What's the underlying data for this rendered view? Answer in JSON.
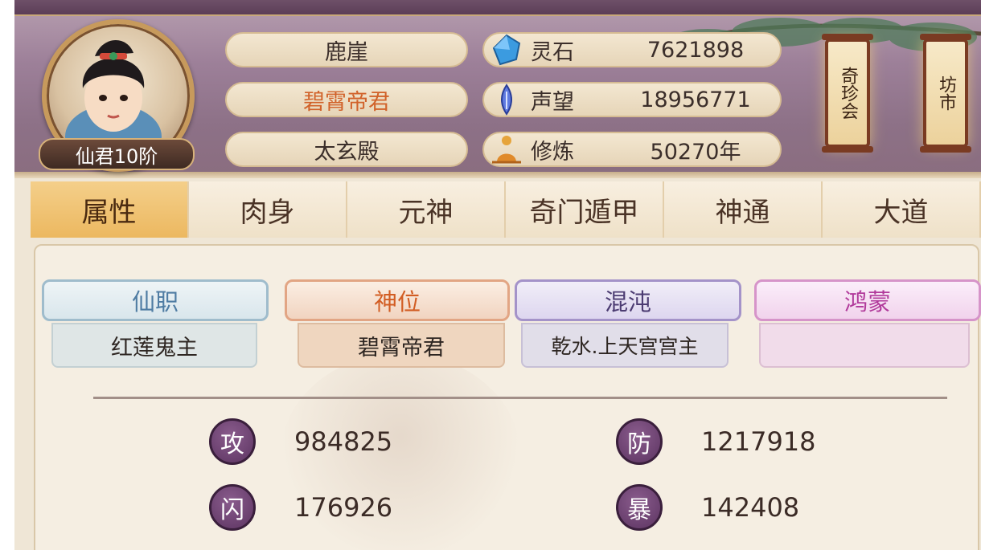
{
  "profile": {
    "rank_badge": "仙君10阶",
    "name": "鹿崖",
    "title": "碧霄帝君",
    "sect": "太玄殿"
  },
  "resources": [
    {
      "icon": "spirit-stone-icon",
      "label": "灵石",
      "value": "7621898"
    },
    {
      "icon": "reputation-icon",
      "label": "声望",
      "value": "18956771"
    },
    {
      "icon": "cultivation-icon",
      "label": "修炼",
      "value": "50270年"
    }
  ],
  "lanterns": [
    {
      "label": "奇珍会"
    },
    {
      "label": "坊市"
    }
  ],
  "tabs": [
    {
      "label": "属性",
      "active": true
    },
    {
      "label": "肉身",
      "active": false
    },
    {
      "label": "元神",
      "active": false
    },
    {
      "label": "奇门遁甲",
      "active": false
    },
    {
      "label": "神通",
      "active": false
    },
    {
      "label": "大道",
      "active": false
    }
  ],
  "ranks": [
    {
      "title": "仙职",
      "value": "红莲鬼主",
      "color": "#4f7ca3"
    },
    {
      "title": "神位",
      "value": "碧霄帝君",
      "color": "#d25d23"
    },
    {
      "title": "混沌",
      "value": "乾水.上天宫宫主",
      "color": "#4c3c72"
    },
    {
      "title": "鸿蒙",
      "value": "",
      "color": "#b13a9b"
    }
  ],
  "stats": [
    {
      "glyph": "攻",
      "value": "984825"
    },
    {
      "glyph": "防",
      "value": "1217918"
    },
    {
      "glyph": "闪",
      "value": "176926"
    },
    {
      "glyph": "暴",
      "value": "142408"
    }
  ]
}
